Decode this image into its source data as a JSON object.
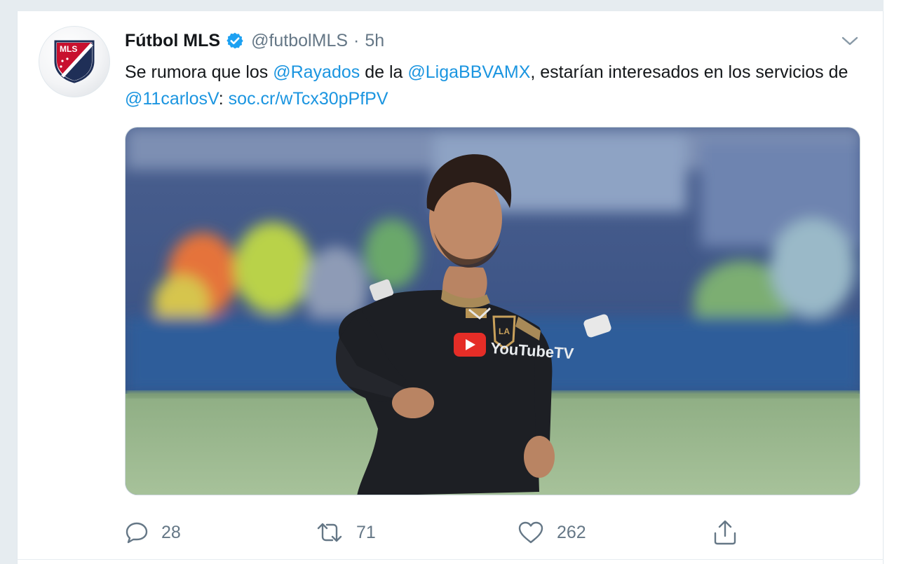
{
  "tweet": {
    "display_name": "Fútbol MLS",
    "handle": "@futbolMLS",
    "separator": "·",
    "time": "5h",
    "verified_icon": "verified-badge-icon",
    "avatar_label": "MLS",
    "text": {
      "part1": "Se rumora que los ",
      "mention1": "@Rayados",
      "part2": " de la ",
      "mention2": "@LigaBBVAMX",
      "part3": ", estarían interesados en los servicios de ",
      "mention3": "@11carlosV",
      "part4": ": ",
      "link": "soc.cr/wTcx30pPfPV"
    },
    "media": {
      "jersey_sponsor": "YouTubeTV",
      "crest_label": "LA"
    },
    "actions": {
      "replies": "28",
      "retweets": "71",
      "likes": "262"
    }
  },
  "colors": {
    "link": "#1b95e0",
    "verified": "#1da1f2",
    "muted": "#657786",
    "background": "#e6ecf0"
  }
}
